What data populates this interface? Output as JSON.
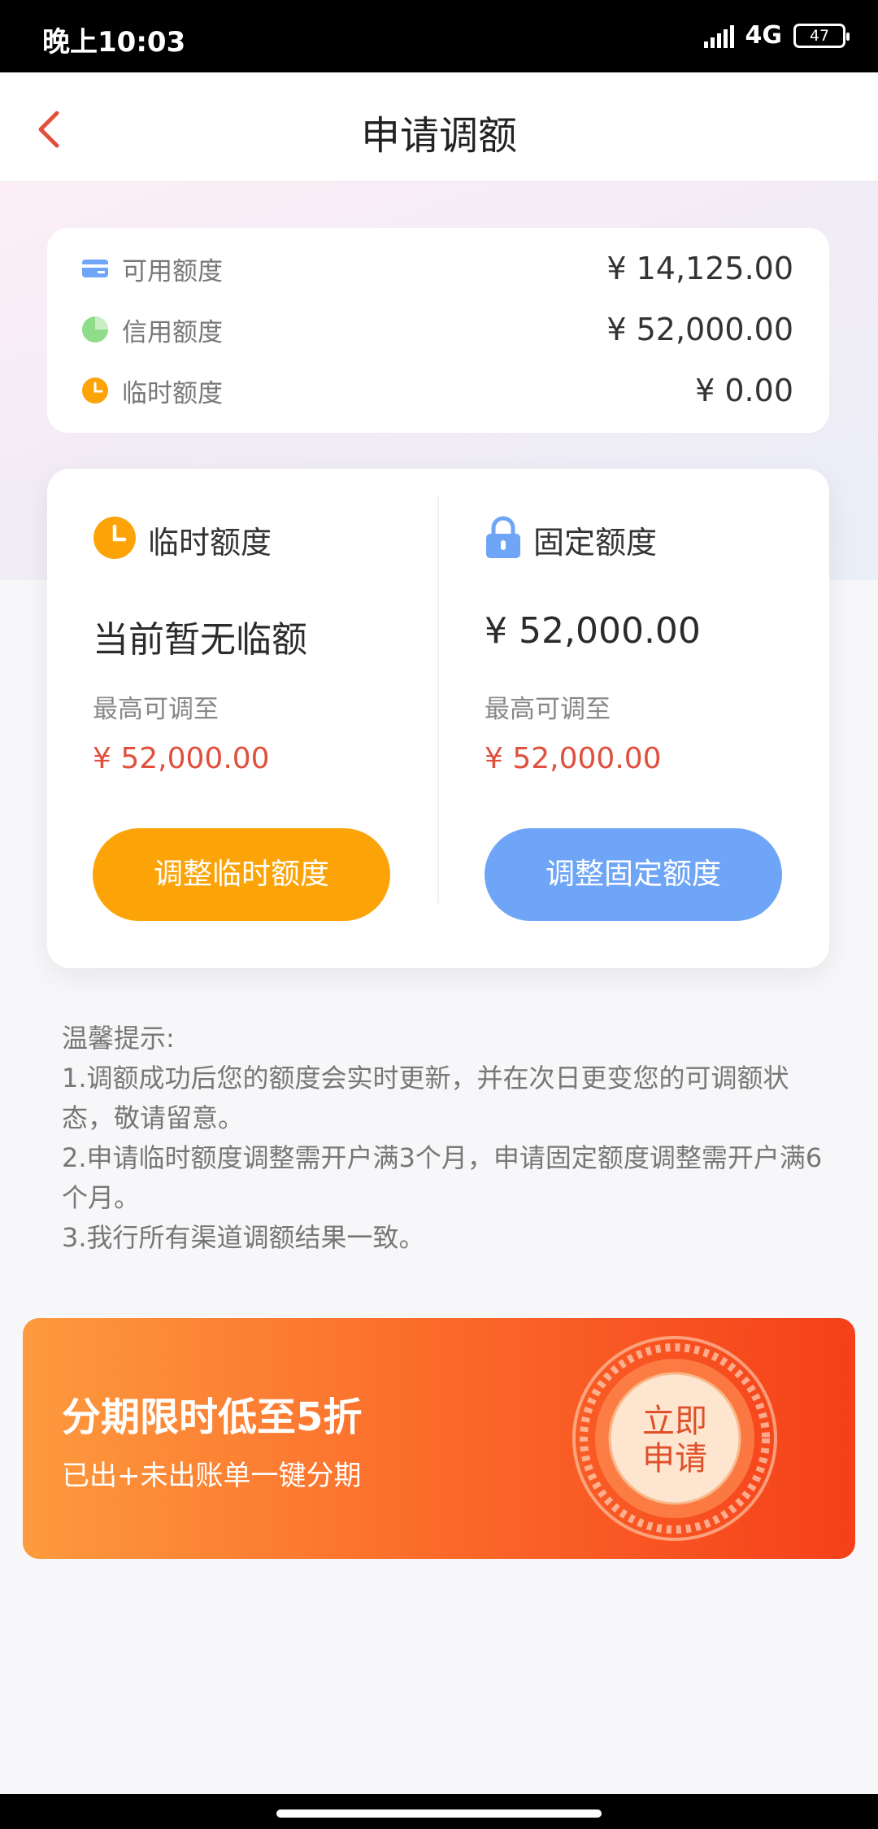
{
  "status_bar": {
    "time": "晚上10:03",
    "network": "4G",
    "battery": "47"
  },
  "nav": {
    "title": "申请调额"
  },
  "summary": {
    "rows": [
      {
        "label": "可用额度",
        "value": "¥ 14,125.00",
        "icon": "card-icon"
      },
      {
        "label": "信用额度",
        "value": "¥ 52,000.00",
        "icon": "pie-icon"
      },
      {
        "label": "临时额度",
        "value": "¥ 0.00",
        "icon": "clock-icon"
      }
    ]
  },
  "temp": {
    "title": "临时额度",
    "current": "当前暂无临额",
    "max_label": "最高可调至",
    "max_value": "¥ 52,000.00",
    "button": "调整临时额度"
  },
  "fixed": {
    "title": "固定额度",
    "current": "¥ 52,000.00",
    "max_label": "最高可调至",
    "max_value": "¥ 52,000.00",
    "button": "调整固定额度"
  },
  "tips": {
    "title": "温馨提示:",
    "lines": [
      "1.调额成功后您的额度会实时更新，并在次日更变您的可调额状态，敬请留意。",
      "2.申请临时额度调整需开户满3个月，申请固定额度调整需开户满6个月。",
      "3.我行所有渠道调额结果一致。"
    ]
  },
  "banner": {
    "headline": "分期限时低至5折",
    "subline": "已出+未出账单一键分期",
    "badge_line1": "立即",
    "badge_line2": "申请"
  },
  "colors": {
    "orange_button": "#fca407",
    "blue_button": "#6ea5f7",
    "red_value": "#e0503c",
    "back_arrow": "#e0503c"
  }
}
